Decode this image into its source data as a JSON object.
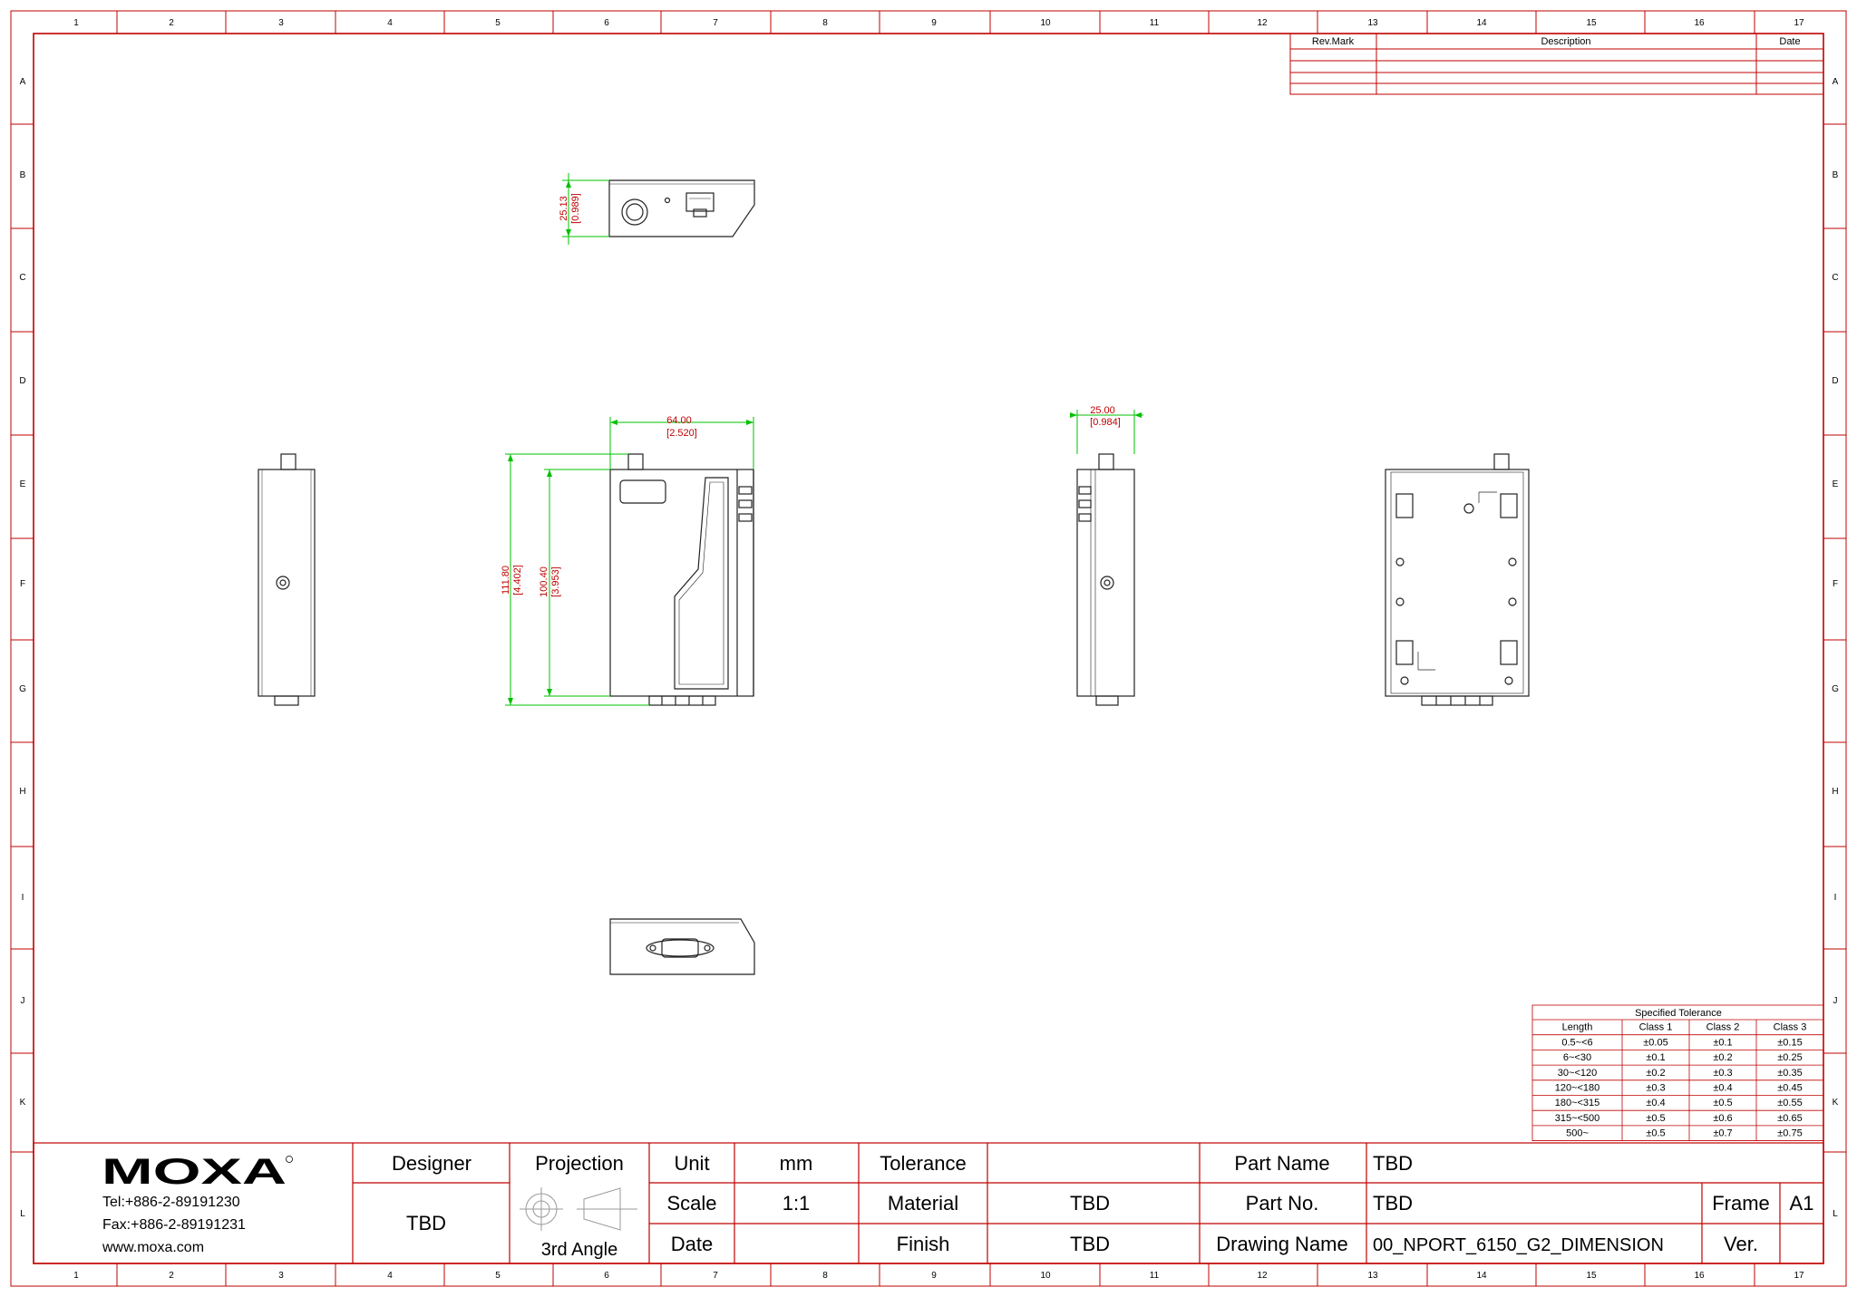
{
  "border": {
    "columns": [
      "1",
      "2",
      "3",
      "4",
      "5",
      "6",
      "7",
      "8",
      "9",
      "10",
      "11",
      "12",
      "13",
      "14",
      "15",
      "16",
      "17"
    ],
    "rows": [
      "A",
      "B",
      "C",
      "D",
      "E",
      "F",
      "G",
      "H",
      "I",
      "J",
      "K",
      "L"
    ]
  },
  "revision_table": {
    "headers": [
      "Rev.Mark",
      "Description",
      "Date"
    ]
  },
  "dimensions": {
    "top_height": "25.13",
    "top_height_in": "[0.989]",
    "width": "64.00",
    "width_in": "[2.520]",
    "height_total": "111.80",
    "height_total_in": "[4.402]",
    "height_body": "100.40",
    "height_body_in": "[3.953]",
    "depth": "25.00",
    "depth_in": "[0.984]"
  },
  "tolerance": {
    "title": "Specified Tolerance",
    "headers": [
      "Length",
      "Class 1",
      "Class 2",
      "Class 3"
    ],
    "rows": [
      [
        "0.5~<6",
        "±0.05",
        "±0.1",
        "±0.15"
      ],
      [
        "6~<30",
        "±0.1",
        "±0.2",
        "±0.25"
      ],
      [
        "30~<120",
        "±0.2",
        "±0.3",
        "±0.35"
      ],
      [
        "120~<180",
        "±0.3",
        "±0.4",
        "±0.45"
      ],
      [
        "180~<315",
        "±0.4",
        "±0.5",
        "±0.55"
      ],
      [
        "315~<500",
        "±0.5",
        "±0.6",
        "±0.65"
      ],
      [
        "500~",
        "±0.5",
        "±0.7",
        "±0.75"
      ]
    ]
  },
  "title_block": {
    "logo": "MOXA",
    "tel": "Tel:+886-2-89191230",
    "fax": "Fax:+886-2-89191231",
    "web": "www.moxa.com",
    "designer_label": "Designer",
    "designer_value": "TBD",
    "projection_label": "Projection",
    "projection_value": "3rd Angle",
    "unit_label": "Unit",
    "unit_value": "mm",
    "scale_label": "Scale",
    "scale_value": "1:1",
    "date_label": "Date",
    "date_value": "",
    "tolerance_label": "Tolerance",
    "tolerance_value": "",
    "material_label": "Material",
    "material_value": "TBD",
    "finish_label": "Finish",
    "finish_value": "TBD",
    "part_name_label": "Part Name",
    "part_name_value": "TBD",
    "part_no_label": "Part No.",
    "part_no_value": "TBD",
    "drawing_name_label": "Drawing Name",
    "drawing_name_value": "00_NPORT_6150_G2_DIMENSION",
    "frame_label": "Frame",
    "frame_value": "A1",
    "ver_label": "Ver.",
    "ver_value": ""
  },
  "colors": {
    "frame": "#c00000",
    "dimension_line": "#00c000",
    "dimension_text": "#c00000",
    "drawing": "#222222"
  }
}
